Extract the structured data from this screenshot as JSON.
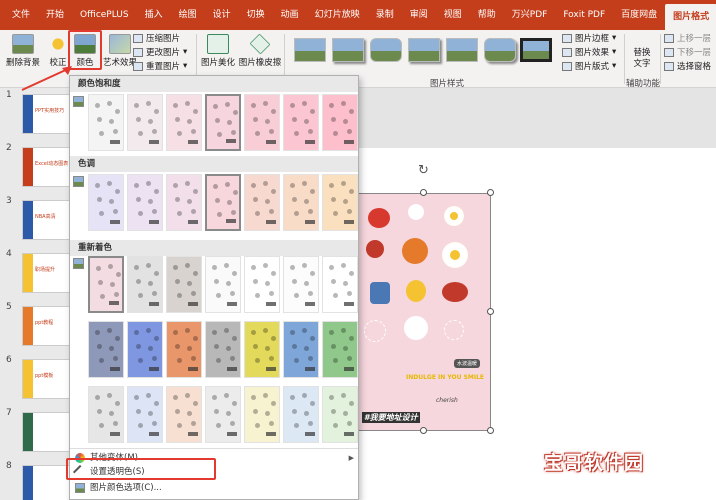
{
  "tabs": [
    "文件",
    "开始",
    "OfficePLUS",
    "插入",
    "绘图",
    "设计",
    "切换",
    "动画",
    "幻灯片放映",
    "录制",
    "审阅",
    "视图",
    "帮助",
    "万兴PDF",
    "Foxit PDF",
    "百度网盘",
    "图片格式"
  ],
  "active_tab": "图片格式",
  "ribbon": {
    "remove_bg": "删除背景",
    "correct": "校正",
    "color": "颜色",
    "artistic": "艺术效果",
    "compress": "压缩图片",
    "change": "更改图片",
    "reset": "重置图片",
    "beautify": "图片美化",
    "eraser": "图片橡皮擦",
    "styles_group": "图片样式",
    "border": "图片边框",
    "effects": "图片效果",
    "layout": "图片版式",
    "alt_text_line1": "替换",
    "alt_text_line2": "文字",
    "aux_group": "辅助功能",
    "bring_forward": "上移一层",
    "send_backward": "下移一层",
    "selection_pane": "选择窗格"
  },
  "slide_numbers": [
    "1",
    "2",
    "3",
    "4",
    "5",
    "6",
    "7",
    "8"
  ],
  "slide_titles": [
    "PPT实用技巧",
    "Excel动态图表",
    "NBA高清",
    "职场提升",
    "ppt教程",
    "ppt模板",
    "",
    ""
  ],
  "dropdown": {
    "saturation": "颜色饱和度",
    "tone": "色调",
    "recolor": "重新着色",
    "more_variants": "其他变体(M)",
    "set_transparent": "设置透明色(S)",
    "color_options": "图片颜色选项(C)..."
  },
  "picture_text": {
    "indulge": "INDULGE IN YOU SMILE",
    "cherish": "cherish",
    "bubble": "水波温暖",
    "banner": "#我要地址设计"
  },
  "watermark": "宝哥软件园",
  "colors": {
    "accent": "#c43e1c",
    "highlight": "#e23a2e"
  }
}
